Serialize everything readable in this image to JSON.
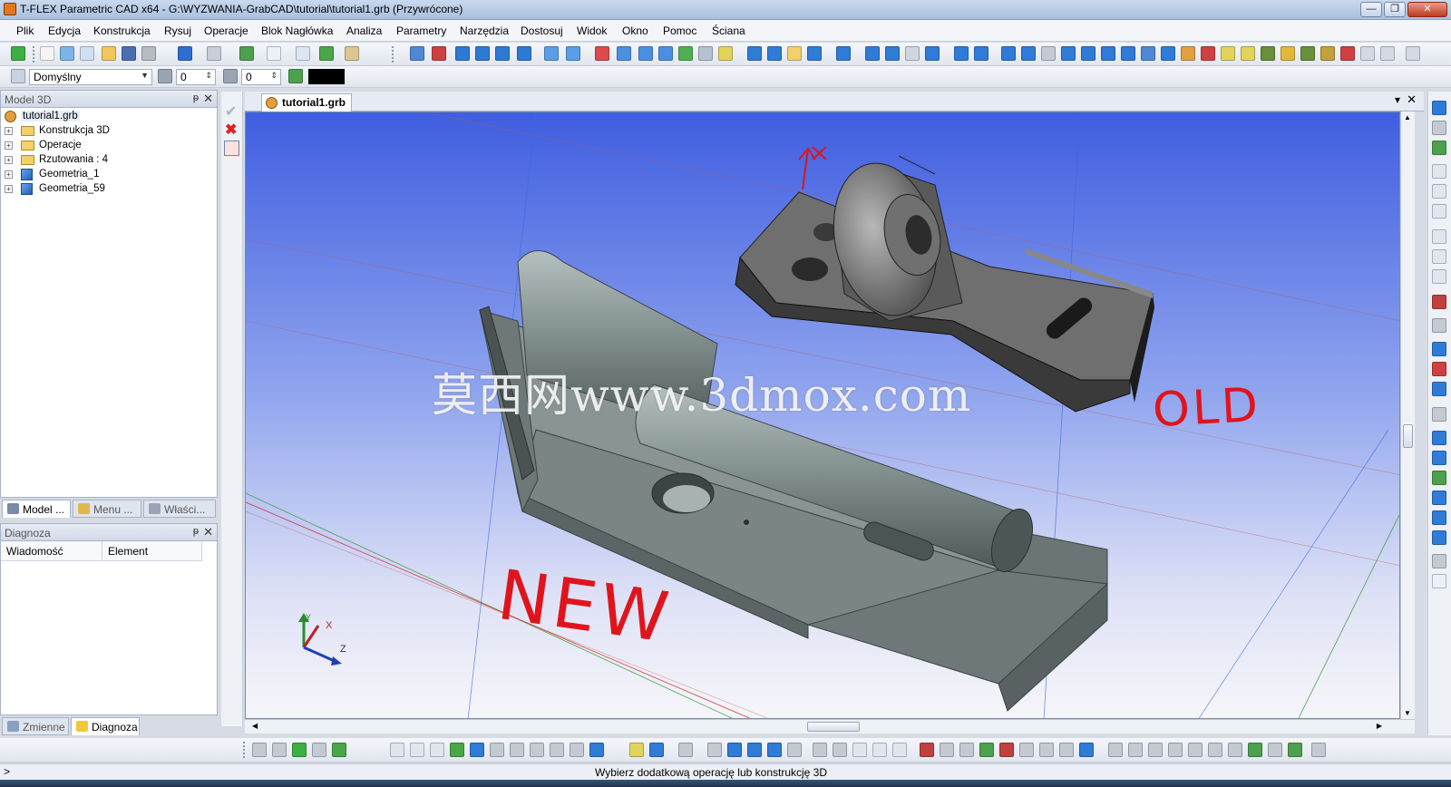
{
  "window": {
    "title": "T-FLEX Parametric CAD x64 - G:\\WYZWANIA-GrabCAD\\tutorial\\tutorial1.grb (Przywrócone)",
    "controls": {
      "minimize": "—",
      "maximize": "❐",
      "close": "✕"
    }
  },
  "menu": {
    "items": [
      "Plik",
      "Edycja",
      "Konstrukcja",
      "Rysuj",
      "Operacje",
      "Blok Nagłówka",
      "Analiza",
      "Parametry",
      "Narzędzia",
      "Dostosuj",
      "Widok",
      "Okno",
      "Pomoc",
      "Ściana"
    ]
  },
  "toolbar2": {
    "style_combo": "Domyślny",
    "layer_value": "0",
    "priority_value": "0",
    "color_swatch": "#000000"
  },
  "model_panel": {
    "title": "Model 3D",
    "pin": "ᵽ",
    "close": "✕",
    "root": "tutorial1.grb",
    "items": [
      {
        "label": "Konstrukcja 3D",
        "icon": "folder-icon"
      },
      {
        "label": "Operacje",
        "icon": "folder-icon"
      },
      {
        "label": "Rzutowania : 4",
        "icon": "folder-icon"
      },
      {
        "label": "Geometria_1",
        "icon": "cube-icon"
      },
      {
        "label": "Geometria_59",
        "icon": "cube-icon"
      }
    ],
    "tabs": [
      "Model ...",
      "Menu ...",
      "Właści..."
    ]
  },
  "diag_panel": {
    "title": "Diagnoza",
    "pin": "ᵽ",
    "close": "✕",
    "columns": [
      "Wiadomość",
      "Element"
    ],
    "tabs": [
      "Zmienne",
      "Diagnoza"
    ]
  },
  "document": {
    "tab": "tutorial1.grb",
    "strip_controls": {
      "menu": "▾",
      "close": "✕"
    }
  },
  "viewport": {
    "watermark": "莫西网www.3dmox.com",
    "annotation_new": "NEW",
    "annotation_old": "OLD",
    "axis_labels": {
      "x": "X",
      "y": "Y",
      "z": "Z"
    }
  },
  "status": {
    "message": "Wybierz dodatkową operację lub konstrukcję 3D"
  },
  "colors": {
    "viewport_top": "#3f5ee0",
    "viewport_bottom": "#f6f6fa",
    "part_gray": "#7b8585",
    "annotation_red": "#e0141c"
  }
}
